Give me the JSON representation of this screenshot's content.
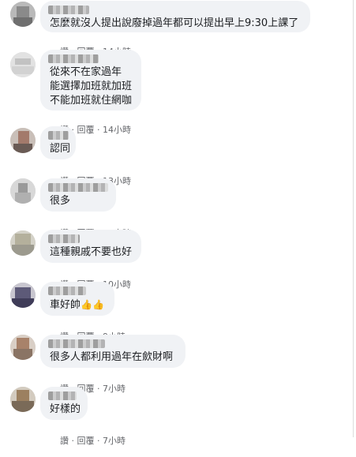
{
  "comments": [
    {
      "text": "怎麼就沒人提出說廢掉過年都可以提出早上9:30上課了",
      "actions": {
        "like": "讚",
        "reply": "回覆",
        "time": "14小時"
      }
    },
    {
      "text": "從來不在家過年\n能選擇加班就加班\n不能加班就住網咖",
      "actions": {
        "like": "讚",
        "reply": "回覆",
        "time": "14小時"
      }
    },
    {
      "text": "認同",
      "actions": {
        "like": "讚",
        "reply": "回覆",
        "time": "13小時"
      }
    },
    {
      "text": "很多",
      "actions": {
        "like": "讚",
        "reply": "回覆",
        "time": "12小時"
      }
    },
    {
      "text": "這種親戚不要也好",
      "actions": {
        "like": "讚",
        "reply": "回覆",
        "time": "10小時"
      }
    },
    {
      "text": "車好帥",
      "emoji": "👍👍",
      "actions": {
        "like": "讚",
        "reply": "回覆",
        "time": "9小時"
      }
    },
    {
      "text": "很多人都利用過年在歛財啊",
      "actions": {
        "like": "讚",
        "reply": "回覆",
        "time": "7小時"
      }
    },
    {
      "text": "好樣的",
      "actions": {
        "like": "讚",
        "reply": "回覆",
        "time": "7小時"
      }
    }
  ],
  "separator": " · ",
  "colors": {
    "bubble": "#f0f2f5",
    "text": "#1c1e21",
    "meta": "#65676b"
  }
}
